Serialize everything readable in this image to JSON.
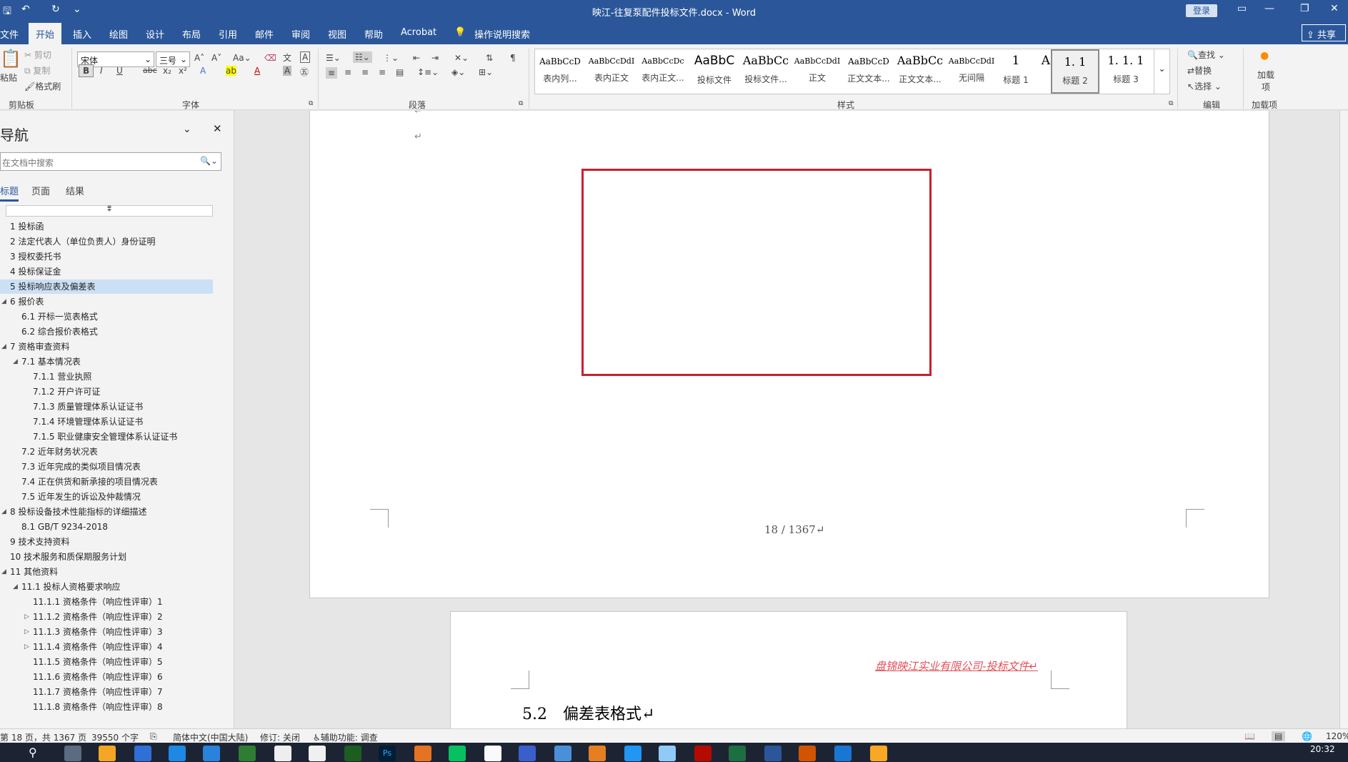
{
  "window": {
    "title": "映江-往复泵配件投标文件.docx  -  Word",
    "login_label": "登录"
  },
  "ribbon_tabs": [
    "文件",
    "开始",
    "插入",
    "绘图",
    "设计",
    "布局",
    "引用",
    "邮件",
    "审阅",
    "视图",
    "帮助",
    "Acrobat"
  ],
  "tell_me": "操作说明搜索",
  "share_label": "共享",
  "clipboard": {
    "paste": "粘贴",
    "cut": "剪切",
    "copy": "复制",
    "format_painter": "格式刷",
    "label": "剪贴板"
  },
  "font_group": {
    "font_name": "宋体",
    "font_size": "三号",
    "label": "字体",
    "bold": "B",
    "italic": "I",
    "underline": "U",
    "strike": "abc",
    "subscript": "x₂",
    "superscript": "x²"
  },
  "paragraph_group": {
    "label": "段落"
  },
  "styles_group": {
    "label": "样式",
    "items": [
      {
        "sample": "AaBbCcD",
        "name": "表内列..."
      },
      {
        "sample": "AaBbCcDdI",
        "name": "表内正文"
      },
      {
        "sample": "AaBbCcDc",
        "name": "表内正文..."
      },
      {
        "sample": "AaBbC",
        "name": "投标文件"
      },
      {
        "sample": "AaBbCc",
        "name": "投标文件..."
      },
      {
        "sample": "AaBbCcDdI",
        "name": "正文"
      },
      {
        "sample": "AaBbCcD",
        "name": "正文文本..."
      },
      {
        "sample": "AaBbCc",
        "name": "正文文本..."
      },
      {
        "sample": "AaBbCcDdI",
        "name": "无间隔"
      },
      {
        "sample": "1",
        "name": "标题 1"
      },
      {
        "sample": "Aa",
        "name": ""
      },
      {
        "sample": "1. 1",
        "name": "标题 2"
      },
      {
        "sample": "1. 1. 1",
        "name": "标题 3"
      }
    ]
  },
  "editing_group": {
    "find": "查找",
    "replace": "替换",
    "select": "选择",
    "label": "编辑"
  },
  "addins_group": {
    "load": "加载项",
    "label": "加载项"
  },
  "nav": {
    "title": "导航",
    "search_placeholder": "在文档中搜索",
    "tabs": [
      "标题",
      "页面",
      "结果"
    ],
    "items": [
      {
        "text": "1 投标函",
        "level": 1
      },
      {
        "text": "2 法定代表人（单位负责人）身份证明",
        "level": 1
      },
      {
        "text": "3 授权委托书",
        "level": 1
      },
      {
        "text": "4 投标保证金",
        "level": 1
      },
      {
        "text": "5 投标响应表及偏差表",
        "level": 1,
        "selected": true
      },
      {
        "text": "6 报价表",
        "level": 1,
        "expanded": true
      },
      {
        "text": "6.1 开标一览表格式",
        "level": 2
      },
      {
        "text": "6.2 综合报价表格式",
        "level": 2
      },
      {
        "text": "7 资格审查资料",
        "level": 1,
        "expanded": true
      },
      {
        "text": "7.1 基本情况表",
        "level": 2,
        "expanded": true
      },
      {
        "text": "7.1.1 营业执照",
        "level": 3
      },
      {
        "text": "7.1.2 开户许可证",
        "level": 3
      },
      {
        "text": "7.1.3 质量管理体系认证证书",
        "level": 3
      },
      {
        "text": "7.1.4 环境管理体系认证证书",
        "level": 3
      },
      {
        "text": "7.1.5 职业健康安全管理体系认证证书",
        "level": 3
      },
      {
        "text": "7.2 近年财务状况表",
        "level": 2
      },
      {
        "text": "7.3 近年完成的类似项目情况表",
        "level": 2
      },
      {
        "text": "7.4 正在供货和新承接的项目情况表",
        "level": 2
      },
      {
        "text": "7.5 近年发生的诉讼及仲裁情况",
        "level": 2
      },
      {
        "text": "8 投标设备技术性能指标的详细描述",
        "level": 1,
        "expanded": true
      },
      {
        "text": "8.1 GB/T 9234-2018",
        "level": 2
      },
      {
        "text": "9 技术支持资料",
        "level": 1
      },
      {
        "text": "10 技术服务和质保期服务计划",
        "level": 1
      },
      {
        "text": "11 其他资料",
        "level": 1,
        "expanded": true
      },
      {
        "text": "11.1 投标人资格要求响应",
        "level": 2,
        "expanded": true
      },
      {
        "text": "11.1.1 资格条件（响应性评审）1",
        "level": 3
      },
      {
        "text": "11.1.2 资格条件（响应性评审）2",
        "level": 3,
        "collapsed": true
      },
      {
        "text": "11.1.3 资格条件（响应性评审）3",
        "level": 3,
        "collapsed": true
      },
      {
        "text": "11.1.4 资格条件（响应性评审）4",
        "level": 3,
        "collapsed": true
      },
      {
        "text": "11.1.5 资格条件（响应性评审）5",
        "level": 3
      },
      {
        "text": "11.1.6 资格条件（响应性评审）6",
        "level": 3
      },
      {
        "text": "11.1.7 资格条件（响应性评审）7",
        "level": 3
      },
      {
        "text": "11.1.8 资格条件（响应性评审）8",
        "level": 3
      }
    ]
  },
  "document": {
    "page_number": "18 / 1367↵",
    "header_text": "盘锦映江实业有限公司-投标文件↵",
    "heading": "5.2　偏差表格式↵",
    "para_mark": "↵"
  },
  "status": {
    "page": "第 18 页，共 1367 页",
    "words": "39550 个字",
    "language": "简体中文(中国大陆)",
    "track": "修订: 关闭",
    "accessibility": "辅助功能: 调查",
    "zoom": "120%"
  },
  "taskbar": {
    "time": "20:32"
  },
  "colors": {
    "title_bar": "#2b579a",
    "highlight_rect": "#c8202f",
    "nav_selected": "#cce0f5"
  }
}
